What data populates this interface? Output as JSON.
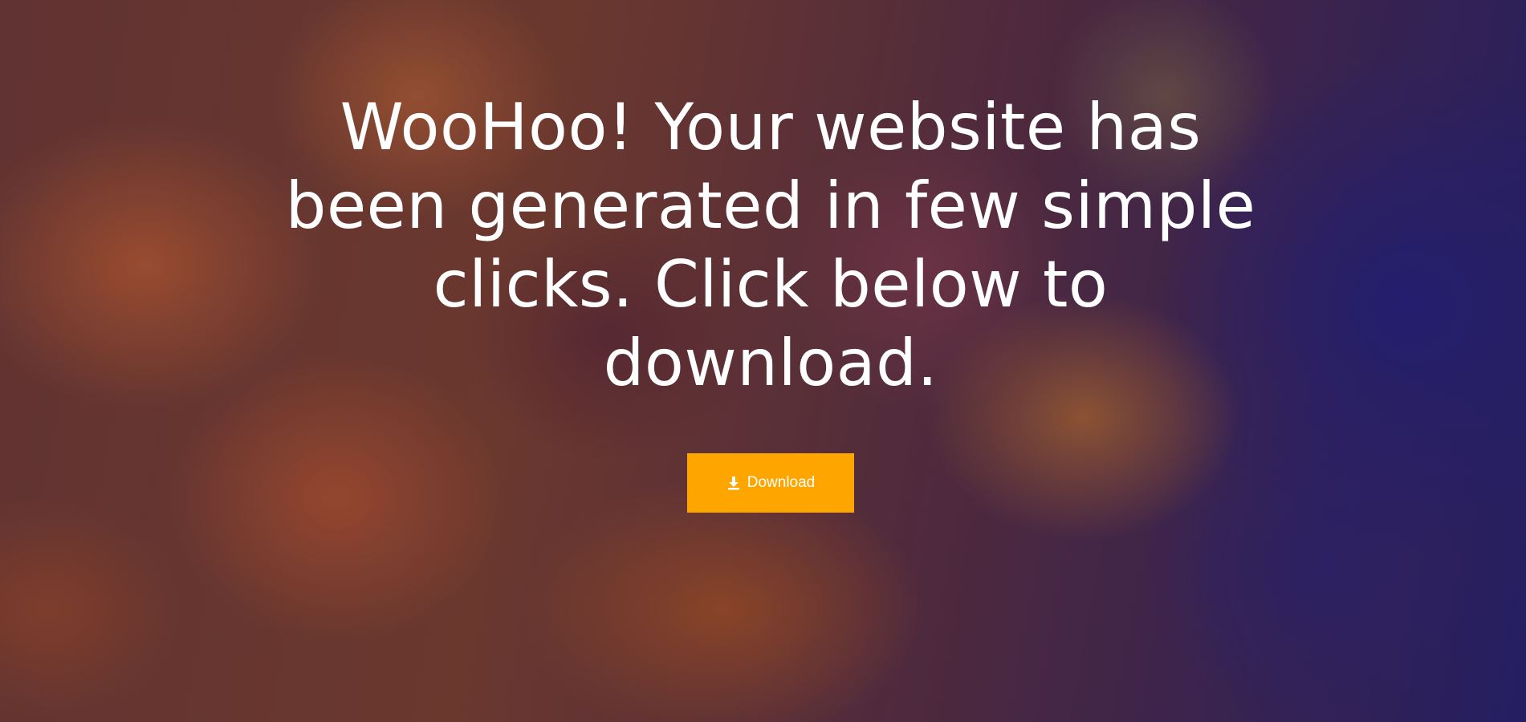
{
  "hero": {
    "title": "WooHoo! Your website has been generated in few simple clicks. Click below to download.",
    "download_button": {
      "label": "Download",
      "icon": "download-icon"
    }
  },
  "colors": {
    "button_background": "#ffa500",
    "text": "#ffffff"
  }
}
